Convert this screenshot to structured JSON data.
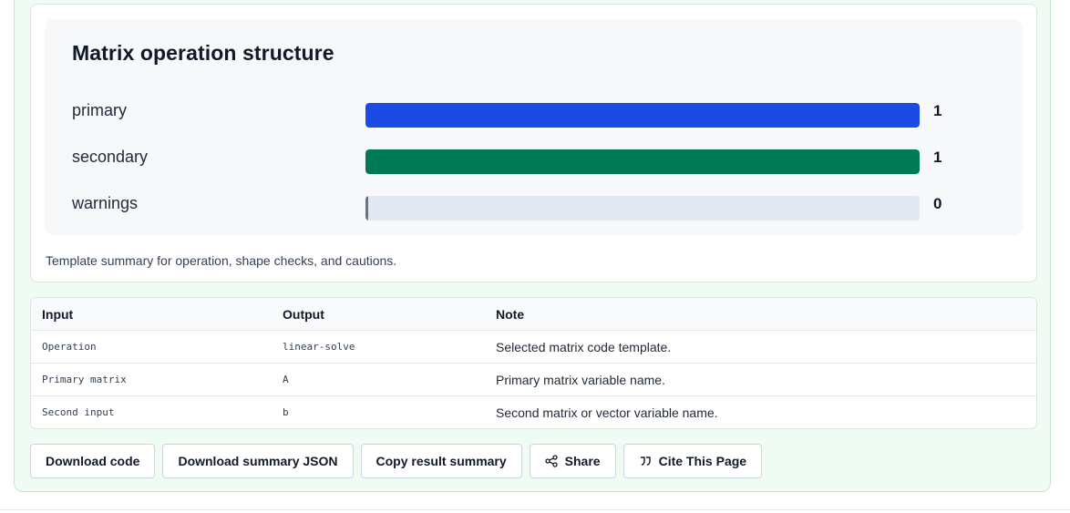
{
  "chart_data": {
    "type": "bar",
    "title": "Matrix operation structure",
    "categories": [
      "primary",
      "secondary",
      "warnings"
    ],
    "values": [
      1,
      1,
      0
    ],
    "xlim": [
      0,
      1
    ],
    "colors": [
      "#1a4be5",
      "#007a55",
      "#64748b"
    ]
  },
  "caption": "Template summary for operation, shape checks, and cautions.",
  "table": {
    "headers": [
      "Input",
      "Output",
      "Note"
    ],
    "rows": [
      [
        "Operation",
        "linear-solve",
        "Selected matrix code template."
      ],
      [
        "Primary matrix",
        "A",
        "Primary matrix variable name."
      ],
      [
        "Second input",
        "b",
        "Second matrix or vector variable name."
      ]
    ]
  },
  "buttons": {
    "download_code": "Download code",
    "download_summary": "Download summary JSON",
    "copy_summary": "Copy result summary",
    "share": "Share",
    "cite": "Cite This Page"
  },
  "icons": {
    "share": "share-icon",
    "cite": "quote-icon"
  }
}
